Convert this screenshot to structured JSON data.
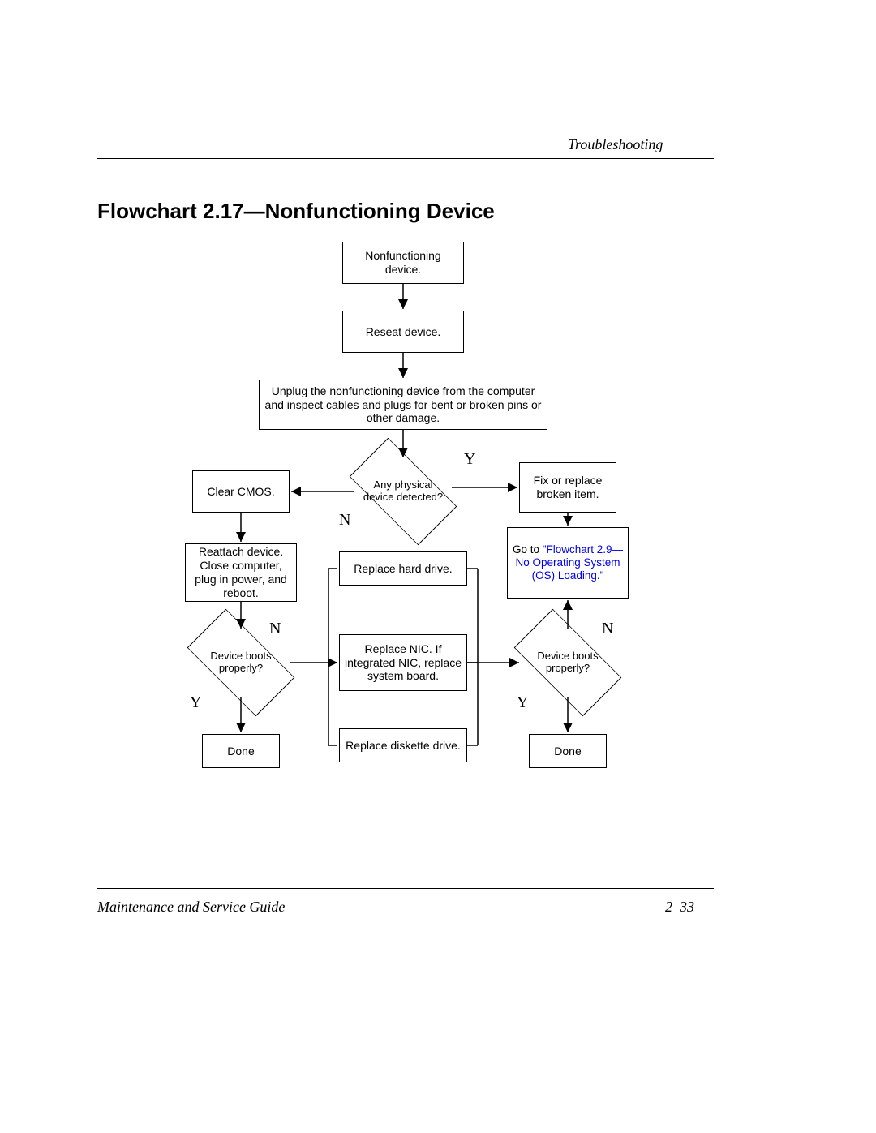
{
  "header": "Troubleshooting",
  "title": "Flowchart 2.17—Nonfunctioning Device",
  "footer_left": "Maintenance and Service Guide",
  "footer_right": "2–33",
  "nodes": {
    "start": "Nonfunctioning device.",
    "reseat": "Reseat device.",
    "unplug": "Unplug the nonfunctioning device from the computer and inspect cables and plugs for bent or broken pins or other damage.",
    "clear_cmos": "Clear CMOS.",
    "any_physical": "Any physical device detected?",
    "fix_replace": "Fix or replace broken item.",
    "reattach": "Reattach device. Close computer, plug in power, and reboot.",
    "replace_hd": "Replace hard drive.",
    "goto_prefix": "Go to ",
    "goto_link": "\"Flowchart 2.9—No Operating System (OS) Loading.\"",
    "boots_left": "Device boots properly?",
    "replace_nic": "Replace NIC. If integrated NIC, replace system board.",
    "boots_right": "Device boots properly?",
    "done_left": "Done",
    "replace_disk": "Replace diskette drive.",
    "done_right": "Done"
  },
  "labels": {
    "y1": "Y",
    "n1": "N",
    "n_left": "N",
    "y_left": "Y",
    "n_right": "N",
    "y_right": "Y"
  }
}
